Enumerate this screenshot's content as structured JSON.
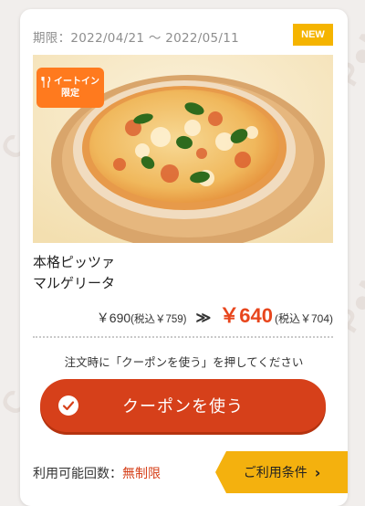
{
  "coupon": {
    "period_label": "期限：",
    "period_start": "2022/04/21",
    "period_sep": "〜",
    "period_end": "2022/05/11",
    "badge": "NEW",
    "tag_line1": "イートイン",
    "tag_line2": "限定",
    "name_line1": "本格ピッツァ",
    "name_line2": "マルゲリータ",
    "old_price": "￥690",
    "old_tax": "(税込￥759)",
    "arrow": "≫",
    "new_price": "￥640",
    "new_tax": "(税込￥704)",
    "instruction": "注文時に「クーポンを使う」を押してください",
    "use_button": "クーポンを使う",
    "usage_label": "利用可能回数：",
    "usage_value": "無制限",
    "conditions_button": "ご利用条件"
  },
  "colors": {
    "accent": "#d6401a",
    "badge": "#f5b400",
    "conditions": "#f4b10e",
    "tag": "#ff7a1e"
  },
  "icons": {
    "use_button": "check-icon",
    "conditions": "chevron-right-icon",
    "tag": "fork-knife-icon"
  }
}
